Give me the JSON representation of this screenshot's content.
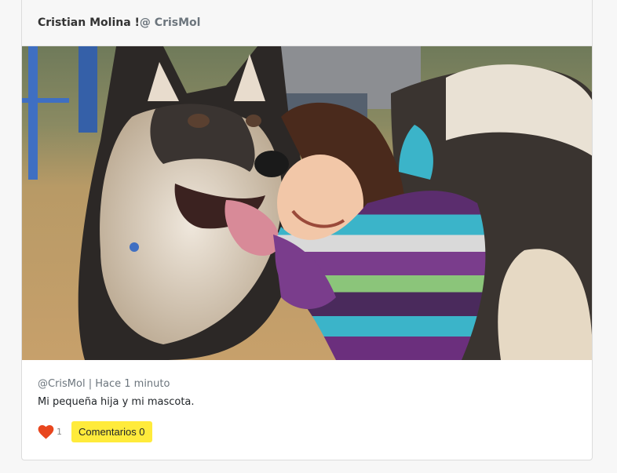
{
  "post": {
    "author_name": "Cristian Molina !",
    "author_handle": "@ CrisMol",
    "photo_alt": "",
    "meta": "@CrisMol | Hace 1 minuto",
    "caption": "Mi pequeña hija y mi mascota.",
    "likes": "1",
    "comments_label": "Comentarios 0"
  },
  "icons": {
    "like": "heart-icon"
  },
  "colors": {
    "heart": "#e8461e",
    "comments_button": "#ffeb3b",
    "header_bg": "#f7f7f7",
    "meta_text": "#6c757d"
  }
}
